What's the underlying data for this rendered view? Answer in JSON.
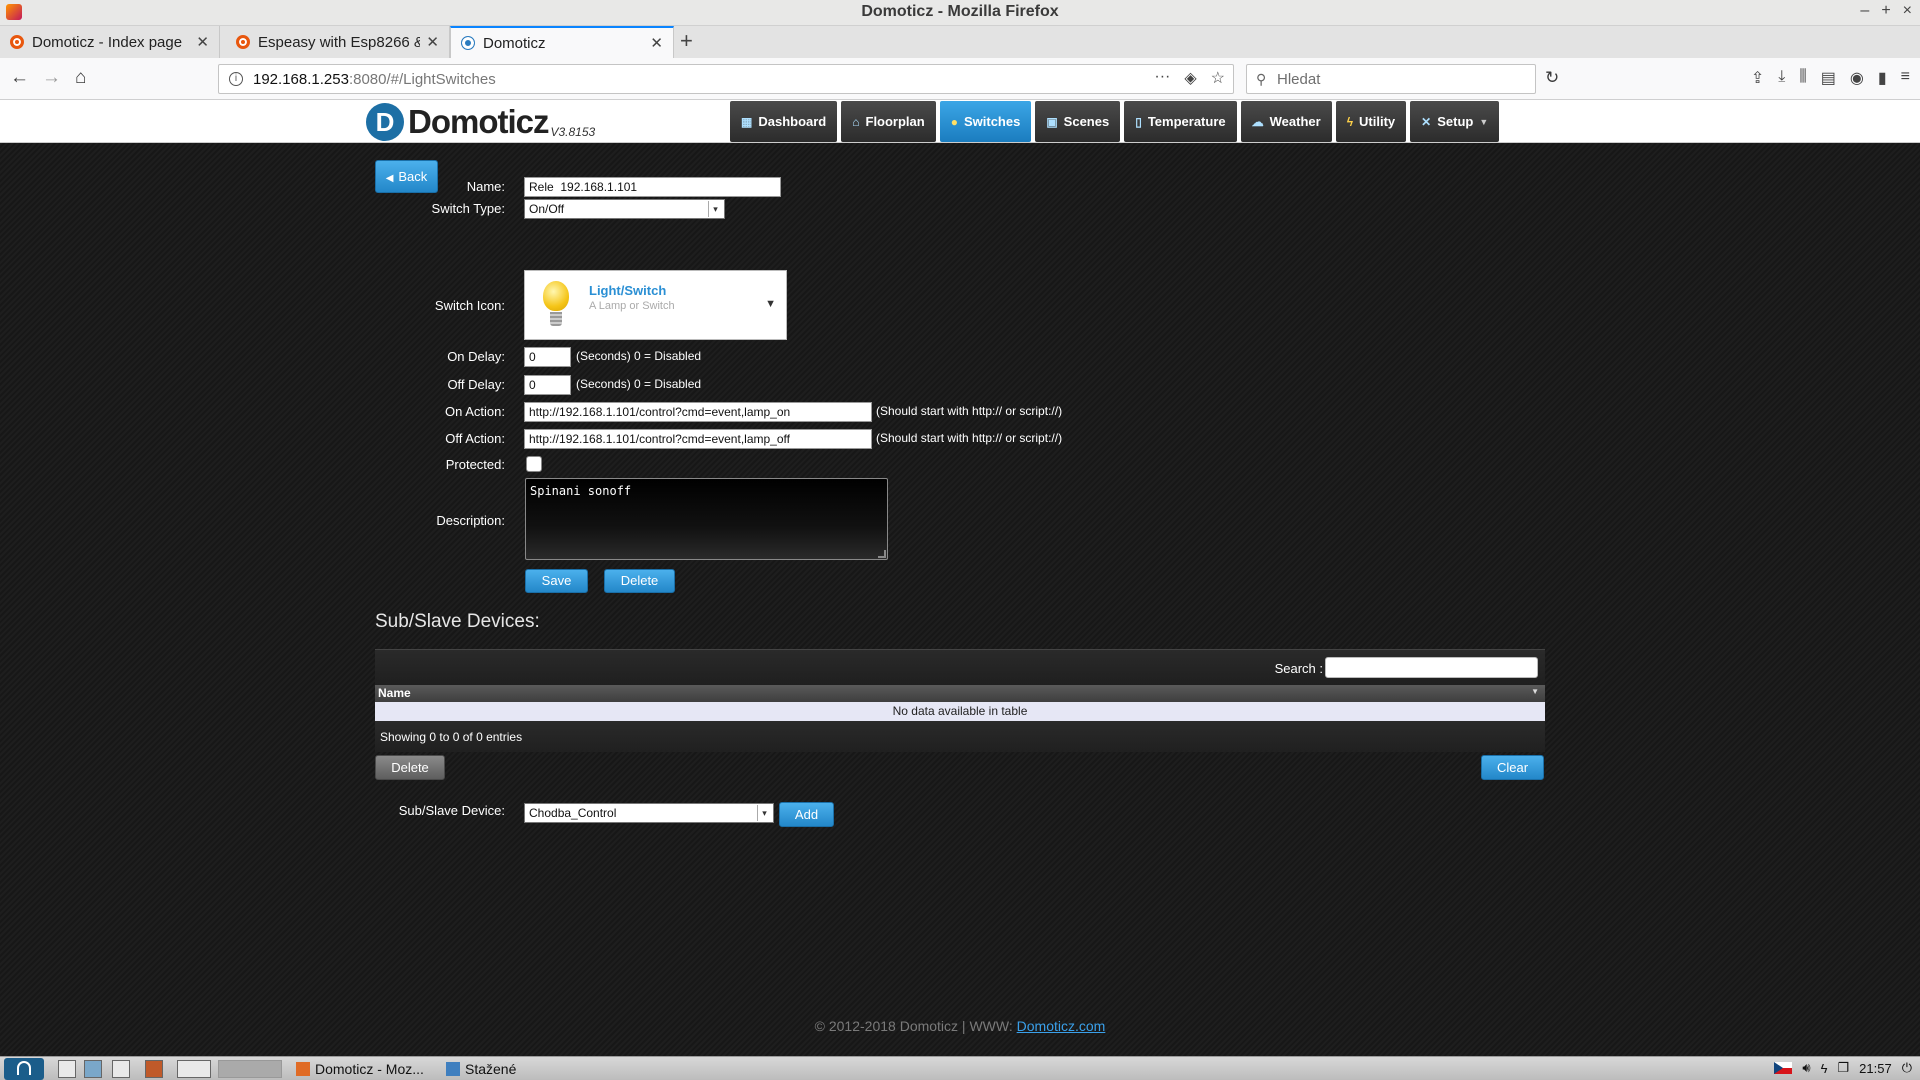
{
  "window": {
    "title": "Domoticz - Mozilla Firefox"
  },
  "tabs": [
    {
      "label": "Domoticz - Index page",
      "active": false
    },
    {
      "label": "Espeasy with Esp8266 &",
      "active": false
    },
    {
      "label": "Domoticz",
      "active": true
    }
  ],
  "urlbar": {
    "host": "192.168.1.253",
    "path": ":8080/#/LightSwitches"
  },
  "searchbar": {
    "placeholder": "Hledat"
  },
  "app": {
    "logo_text": "Domoticz",
    "version": "V3.8153",
    "nav": [
      {
        "label": "Dashboard",
        "icon": "dashboard-icon"
      },
      {
        "label": "Floorplan",
        "icon": "floorplan-icon"
      },
      {
        "label": "Switches",
        "icon": "bulb-icon",
        "active": true
      },
      {
        "label": "Scenes",
        "icon": "scenes-icon"
      },
      {
        "label": "Temperature",
        "icon": "thermometer-icon"
      },
      {
        "label": "Weather",
        "icon": "cloud-icon"
      },
      {
        "label": "Utility",
        "icon": "utility-icon"
      },
      {
        "label": "Setup",
        "icon": "tools-icon",
        "has_dropdown": true
      }
    ]
  },
  "form": {
    "back_label": "Back",
    "name_label": "Name:",
    "name_value": "Rele  192.168.1.101",
    "switch_type_label": "Switch Type:",
    "switch_type_value": "On/Off",
    "switch_icon_label": "Switch Icon:",
    "icon_title": "Light/Switch",
    "icon_subtitle": "A Lamp or Switch",
    "on_delay_label": "On Delay:",
    "on_delay_value": "0",
    "off_delay_label": "Off Delay:",
    "off_delay_value": "0",
    "delay_hint": "(Seconds) 0 = Disabled",
    "on_action_label": "On Action:",
    "on_action_value": "http://192.168.1.101/control?cmd=event,lamp_on",
    "off_action_label": "Off Action:",
    "off_action_value": "http://192.168.1.101/control?cmd=event,lamp_off",
    "action_hint": "(Should start with http:// or script://)",
    "protected_label": "Protected:",
    "protected_checked": false,
    "description_label": "Description:",
    "description_value": "Spinani sonoff",
    "save_label": "Save",
    "delete_label": "Delete"
  },
  "subslave": {
    "title": "Sub/Slave Devices:",
    "search_label": "Search :",
    "column_name": "Name",
    "empty_text": "No data available in table",
    "info_text": "Showing 0 to 0 of 0 entries",
    "delete_label": "Delete",
    "clear_label": "Clear",
    "device_label": "Sub/Slave Device:",
    "device_selected": "Chodba_Control",
    "add_label": "Add"
  },
  "footer": {
    "copyright": "© 2012-2018 Domoticz | WWW: ",
    "link_text": "Domoticz.com"
  },
  "taskbar": {
    "apps": [
      {
        "label": "Domoticz - Moz..."
      },
      {
        "label": "Stažené"
      }
    ],
    "clock": "21:57"
  }
}
